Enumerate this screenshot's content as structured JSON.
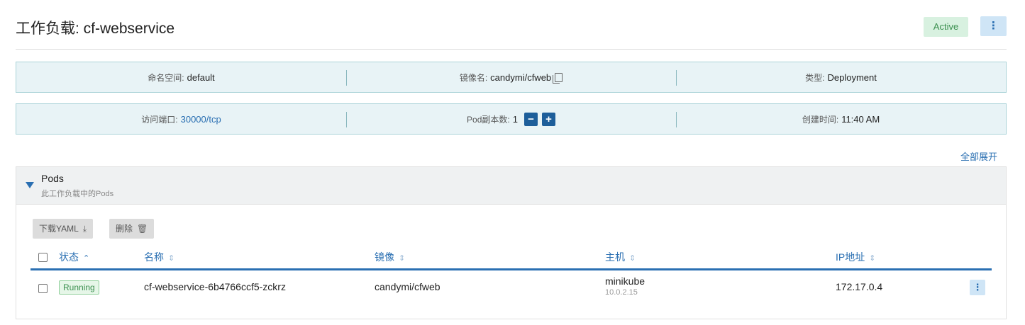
{
  "header": {
    "title": "工作负载: cf-webservice",
    "status": "Active",
    "menu_icon": "kebab-vertical-icon"
  },
  "info_row1": {
    "namespace_label": "命名空间:",
    "namespace_value": "default",
    "image_label": "镜像名:",
    "image_value": "candymi/cfweb",
    "type_label": "类型:",
    "type_value": "Deployment"
  },
  "info_row2": {
    "port_label": "访问端口:",
    "port_value": "30000/tcp",
    "replicas_label": "Pod副本数:",
    "replicas_value": "1",
    "decrement": "−",
    "increment": "+",
    "created_label": "创建时间:",
    "created_value": "11:40 AM"
  },
  "expand_all": "全部展开",
  "pods_panel": {
    "title": "Pods",
    "subtitle": "此工作负载中的Pods",
    "download_label": "下载YAML",
    "delete_label": "删除",
    "columns": [
      "状态",
      "名称",
      "镜像",
      "主机",
      "IP地址"
    ],
    "rows": [
      {
        "status": "Running",
        "name": "cf-webservice-6b4766ccf5-zckrz",
        "image": "candymi/cfweb",
        "host": "minikube",
        "host_ip": "10.0.2.15",
        "ip": "172.17.0.4"
      }
    ]
  },
  "colors": {
    "accent": "#2a6fb2",
    "active_bg": "#d8f1e0",
    "active_text": "#3a8f4e",
    "info_bg": "#e8f3f6",
    "info_border": "#aad3d8"
  }
}
